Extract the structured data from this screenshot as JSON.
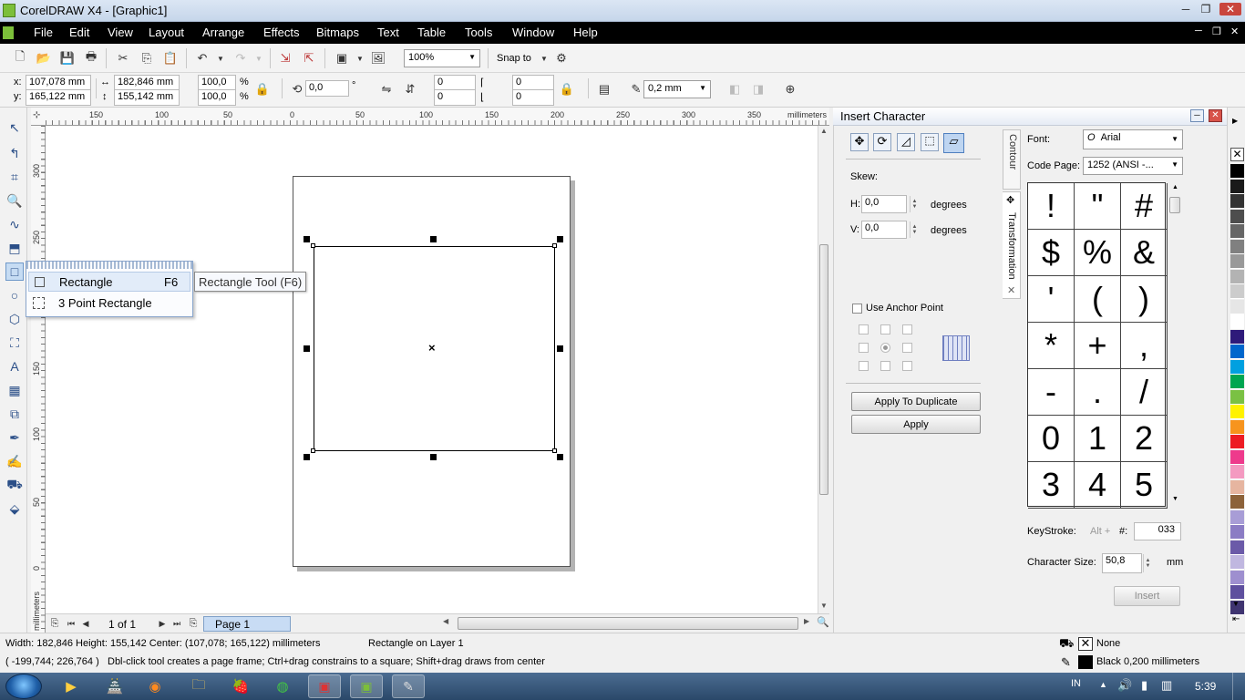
{
  "window": {
    "title": "CorelDRAW X4 - [Graphic1]"
  },
  "menu": [
    "File",
    "Edit",
    "View",
    "Layout",
    "Arrange",
    "Effects",
    "Bitmaps",
    "Text",
    "Table",
    "Tools",
    "Window",
    "Help"
  ],
  "menu_underline": [
    "F",
    "E",
    "V",
    "L",
    "A",
    "c",
    "B",
    "T",
    "T",
    "o",
    "W",
    "H"
  ],
  "standard_toolbar": {
    "zoom": "100%",
    "snap_to": "Snap to"
  },
  "property_bar": {
    "x_label": "x:",
    "x": "107,078 mm",
    "y_label": "y:",
    "y": "165,122 mm",
    "width": "182,846 mm",
    "height": "155,142 mm",
    "scale_x": "100,0",
    "scale_y": "100,0",
    "percent": "%",
    "rotation": "0,0",
    "degree": "°",
    "corner_tl": "0",
    "corner_bl": "0",
    "corner_tr": "0",
    "corner_br": "0",
    "outline_width": "0,2 mm"
  },
  "ruler": {
    "units": "millimeters",
    "h_ticks": [
      "150",
      "100",
      "50",
      "0",
      "50",
      "100",
      "150",
      "200",
      "250",
      "300",
      "350"
    ],
    "v_ticks": [
      "300",
      "250",
      "200",
      "150",
      "100",
      "50",
      "0"
    ],
    "v_units": "millimeters"
  },
  "flyout": {
    "items": [
      {
        "label": "Rectangle",
        "underline": "R",
        "shortcut": "F6"
      },
      {
        "label": "3 Point Rectangle",
        "underline": "3",
        "shortcut": ""
      }
    ],
    "tooltip": "Rectangle Tool (F6)"
  },
  "page_nav": {
    "count": "1 of 1",
    "tab": "Page 1"
  },
  "docker": {
    "title": "Insert Character",
    "side_tabs": [
      "Contour",
      "Transformation"
    ],
    "transform": {
      "skew_label": "Skew:",
      "h_label": "H:",
      "h_value": "0,0",
      "v_label": "V:",
      "v_value": "0,0",
      "unit": "degrees",
      "anchor_label": "Use Anchor Point",
      "apply_duplicate": "Apply To Duplicate",
      "apply": "Apply"
    },
    "charmap": {
      "font_label": "Font:",
      "font": "Arial",
      "codepage_label": "Code Page:",
      "codepage": "1252  (ANSI -...",
      "chars": [
        "!",
        "\"",
        "#",
        "$",
        "%",
        "&",
        "'",
        "(",
        ")",
        "*",
        "+",
        ",",
        "-",
        ".",
        "/",
        "0",
        "1",
        "2",
        "3",
        "4",
        "5"
      ],
      "keystroke_label": "KeyStroke:",
      "alt_label": "Alt +",
      "hash_label": "#:",
      "keystroke": "033",
      "size_label": "Character Size:",
      "size": "50,8",
      "size_unit": "mm",
      "insert": "Insert"
    }
  },
  "palette": [
    "#ffffff",
    "#000000",
    "#1a1a1a",
    "#333333",
    "#4d4d4d",
    "#666666",
    "#808080",
    "#999999",
    "#b3b3b3",
    "#cccccc",
    "#e6e6e6",
    "#ffffff",
    "#2e1a7a",
    "#0066cc",
    "#00a0e0",
    "#00a651",
    "#7ac143",
    "#fff200",
    "#f7941d",
    "#ed1c24",
    "#ee3a8c",
    "#f49ac1",
    "#e6b5a0",
    "#8c6239",
    "#a89dd6",
    "#8b7cc4",
    "#6b5aa8",
    "#c0b7e0",
    "#9e8fcf",
    "#5e4f9e",
    "#3f3470"
  ],
  "status": {
    "dims": "Width: 182,846  Height: 155,142  Center: (107,078; 165,122)  millimeters",
    "layer": "Rectangle on Layer 1",
    "coords": "( -199,744; 226,764 )",
    "hint": "Dbl-click tool creates a page frame; Ctrl+drag constrains to a square; Shift+drag draws from center",
    "fill": "None",
    "outline": "Black  0,200 millimeters"
  },
  "taskbar": {
    "lang": "IN",
    "time": "5:39"
  }
}
